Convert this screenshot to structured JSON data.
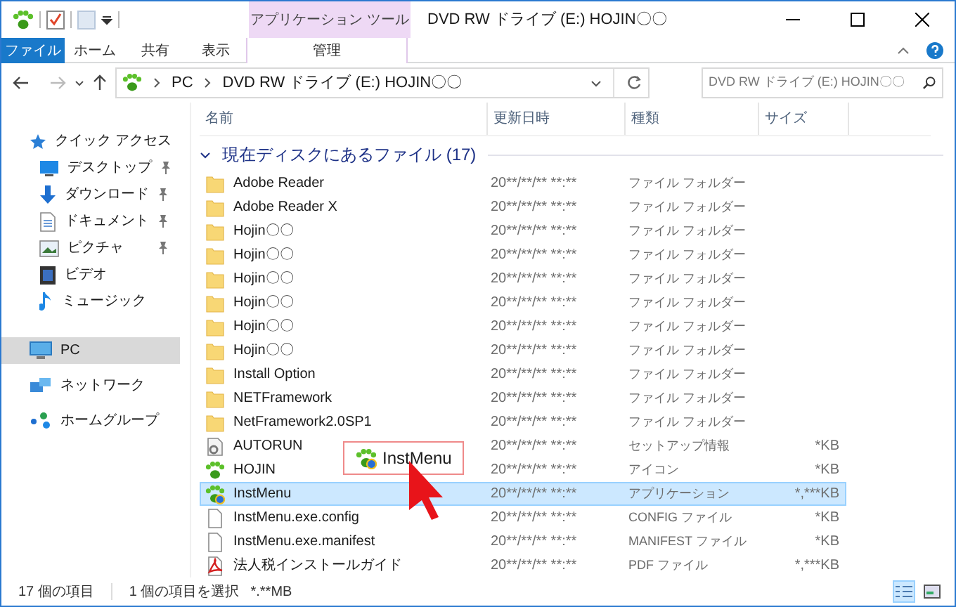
{
  "window": {
    "title": "DVD RW ドライブ (E:) HOJIN〇〇",
    "context_tab": "アプリケーション ツール"
  },
  "ribbon_tabs": [
    {
      "label": "ファイル",
      "selected": true,
      "kind": "file"
    },
    {
      "label": "ホーム",
      "selected": false,
      "kind": "tab"
    },
    {
      "label": "共有",
      "selected": false,
      "kind": "tab"
    },
    {
      "label": "表示",
      "selected": false,
      "kind": "tab"
    },
    {
      "label": "管理",
      "selected": false,
      "kind": "context"
    }
  ],
  "address": {
    "path": [
      "PC",
      "DVD RW ドライブ (E:) HOJIN〇〇"
    ]
  },
  "search": {
    "placeholder": "DVD RW ドライブ (E:) HOJIN〇〇"
  },
  "sidebar": {
    "items": [
      {
        "label": "クイック アクセス",
        "kind": "star",
        "pinned": false,
        "selected": false,
        "indent": false
      },
      {
        "label": "デスクトップ",
        "kind": "desktop",
        "pinned": true,
        "selected": false,
        "indent": true
      },
      {
        "label": "ダウンロード",
        "kind": "download",
        "pinned": true,
        "selected": false,
        "indent": true
      },
      {
        "label": "ドキュメント",
        "kind": "document",
        "pinned": true,
        "selected": false,
        "indent": true
      },
      {
        "label": "ピクチャ",
        "kind": "picture",
        "pinned": true,
        "selected": false,
        "indent": true
      },
      {
        "label": "ビデオ",
        "kind": "video",
        "pinned": false,
        "selected": false,
        "indent": true
      },
      {
        "label": "ミュージック",
        "kind": "music",
        "pinned": false,
        "selected": false,
        "indent": true
      },
      {
        "label": "PC",
        "kind": "pc",
        "pinned": false,
        "selected": true,
        "indent": false
      },
      {
        "label": "ネットワーク",
        "kind": "network",
        "pinned": false,
        "selected": false,
        "indent": false
      },
      {
        "label": "ホームグループ",
        "kind": "homegroup",
        "pinned": false,
        "selected": false,
        "indent": false
      }
    ]
  },
  "table": {
    "columns": [
      "名前",
      "更新日時",
      "種類",
      "サイズ"
    ],
    "group": "現在ディスクにあるファイル (17)",
    "rows": [
      {
        "name": "Adobe Reader",
        "date": "20**/**/** **:**",
        "type": "ファイル フォルダー",
        "kind": "folder",
        "selected": false
      },
      {
        "name": "Adobe Reader X",
        "date": "20**/**/** **:**",
        "type": "ファイル フォルダー",
        "kind": "folder",
        "selected": false
      },
      {
        "name": "Hojin〇〇",
        "date": "20**/**/** **:**",
        "type": "ファイル フォルダー",
        "kind": "folder",
        "selected": false
      },
      {
        "name": "Hojin〇〇",
        "date": "20**/**/** **:**",
        "type": "ファイル フォルダー",
        "kind": "folder",
        "selected": false
      },
      {
        "name": "Hojin〇〇",
        "date": "20**/**/** **:**",
        "type": "ファイル フォルダー",
        "kind": "folder",
        "selected": false
      },
      {
        "name": "Hojin〇〇",
        "date": "20**/**/** **:**",
        "type": "ファイル フォルダー",
        "kind": "folder",
        "selected": false
      },
      {
        "name": "Hojin〇〇",
        "date": "20**/**/** **:**",
        "type": "ファイル フォルダー",
        "kind": "folder",
        "selected": false
      },
      {
        "name": "Hojin〇〇",
        "date": "20**/**/** **:**",
        "type": "ファイル フォルダー",
        "kind": "folder",
        "selected": false
      },
      {
        "name": "Install Option",
        "date": "20**/**/** **:**",
        "type": "ファイル フォルダー",
        "kind": "folder",
        "selected": false
      },
      {
        "name": "NETFramework",
        "date": "20**/**/** **:**",
        "type": "ファイル フォルダー",
        "kind": "folder",
        "selected": false
      },
      {
        "name": "NetFramework2.0SP1",
        "date": "20**/**/** **:**",
        "type": "ファイル フォルダー",
        "kind": "folder",
        "selected": false
      },
      {
        "name": "AUTORUN",
        "date": "20**/**/** **:**",
        "type": "セットアップ情報",
        "size": "*KB",
        "kind": "setup",
        "selected": false
      },
      {
        "name": "HOJIN",
        "date": "20**/**/** **:**",
        "type": "アイコン",
        "size": "*KB",
        "kind": "paw",
        "selected": false
      },
      {
        "name": "InstMenu",
        "date": "20**/**/** **:**",
        "type": "アプリケーション",
        "size": "*,***KB",
        "kind": "app",
        "selected": true
      },
      {
        "name": "InstMenu.exe.config",
        "date": "20**/**/** **:**",
        "type": "CONFIG ファイル",
        "size": "*KB",
        "kind": "file",
        "selected": false
      },
      {
        "name": "InstMenu.exe.manifest",
        "date": "20**/**/** **:**",
        "type": "MANIFEST ファイル",
        "size": "*KB",
        "kind": "file",
        "selected": false
      },
      {
        "name": "法人税インストールガイド",
        "date": "20**/**/** **:**",
        "type": "PDF ファイル",
        "size": "*,***KB",
        "kind": "pdf",
        "selected": false
      }
    ]
  },
  "callout": {
    "label": "InstMenu"
  },
  "status_bar": {
    "count": "17 個の項目",
    "selection": "1 個の項目を選択",
    "size": "*.**MB",
    "views": [
      {
        "kind": "details",
        "selected": true
      },
      {
        "kind": "tiles",
        "selected": false
      }
    ]
  }
}
